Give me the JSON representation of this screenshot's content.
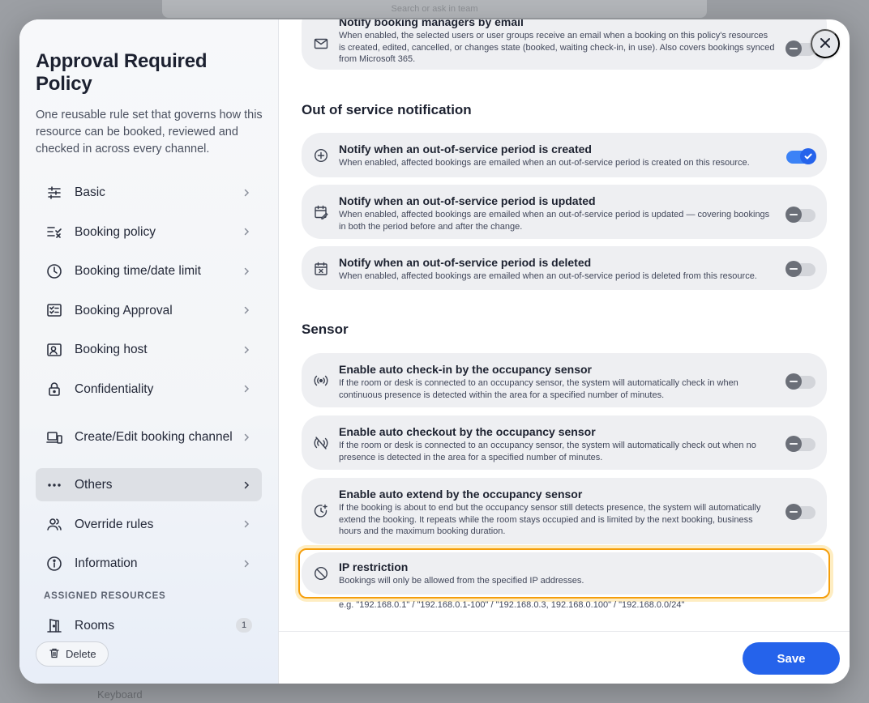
{
  "background": {
    "search_placeholder": "Search or ask in team",
    "bottom_text": "Keyboard"
  },
  "sidebar": {
    "title": "Approval Required Policy",
    "description": "One reusable rule set that governs how this resource can be booked, reviewed and checked in across every channel.",
    "items": [
      {
        "label": "Basic",
        "icon": "sliders-icon"
      },
      {
        "label": "Booking policy",
        "icon": "list-check-icon"
      },
      {
        "label": "Booking time/date limit",
        "icon": "clock-icon"
      },
      {
        "label": "Booking Approval",
        "icon": "approval-list-icon"
      },
      {
        "label": "Booking host",
        "icon": "host-icon"
      },
      {
        "label": "Confidentiality",
        "icon": "lock-icon"
      },
      {
        "label": "Create/Edit booking channel",
        "icon": "devices-icon"
      },
      {
        "label": "Others",
        "icon": "more-dots-icon",
        "active": true
      },
      {
        "label": "Override rules",
        "icon": "users-icon"
      },
      {
        "label": "Information",
        "icon": "info-icon"
      }
    ],
    "assigned_heading": "ASSIGNED RESOURCES",
    "rooms_label": "Rooms",
    "rooms_count": "1",
    "delete_label": "Delete"
  },
  "main": {
    "top_card": {
      "title": "Notify booking managers by email",
      "description": "When enabled, the selected users or user groups receive an email when a booking on this policy's resources is created, edited, cancelled, or changes state (booked, waiting check-in, in use). Also covers bookings synced from Microsoft 365.",
      "enabled": false
    },
    "oos_heading": "Out of service notification",
    "oos_items": [
      {
        "title": "Notify when an out-of-service period is created",
        "description": "When enabled, affected bookings are emailed when an out-of-service period is created on this resource.",
        "enabled": true
      },
      {
        "title": "Notify when an out-of-service period is updated",
        "description": "When enabled, affected bookings are emailed when an out-of-service period is updated — covering bookings in both the period before and after the change.",
        "enabled": false
      },
      {
        "title": "Notify when an out-of-service period is deleted",
        "description": "When enabled, affected bookings are emailed when an out-of-service period is deleted from this resource.",
        "enabled": false
      }
    ],
    "sensor_heading": "Sensor",
    "sensor_items": [
      {
        "title": "Enable auto check-in by the occupancy sensor",
        "description": "If the room or desk is connected to an occupancy sensor, the system will automatically check in when continuous presence is detected within the area for a specified number of minutes.",
        "enabled": false
      },
      {
        "title": "Enable auto checkout by the occupancy sensor",
        "description": "If the room or desk is connected to an occupancy sensor, the system will automatically check out when no presence is detected in the area for a specified number of minutes.",
        "enabled": false
      },
      {
        "title": "Enable auto extend by the occupancy sensor",
        "description": "If the booking is about to end but the occupancy sensor still detects presence, the system will automatically extend the booking. It repeats while the room stays occupied and is limited by the next booking, business hours and the maximum booking duration.",
        "enabled": false
      }
    ],
    "ip": {
      "title": "IP restriction",
      "description": "Bookings will only be allowed from the specified IP addresses.",
      "example": "e.g. \"192.168.0.1\" / \"192.168.0.1-100\" / \"192.168.0.3, 192.168.0.100\" / \"192.168.0.0/24\""
    },
    "save_label": "Save"
  },
  "colors": {
    "accent": "#2563eb",
    "highlight": "#f59e0b"
  }
}
